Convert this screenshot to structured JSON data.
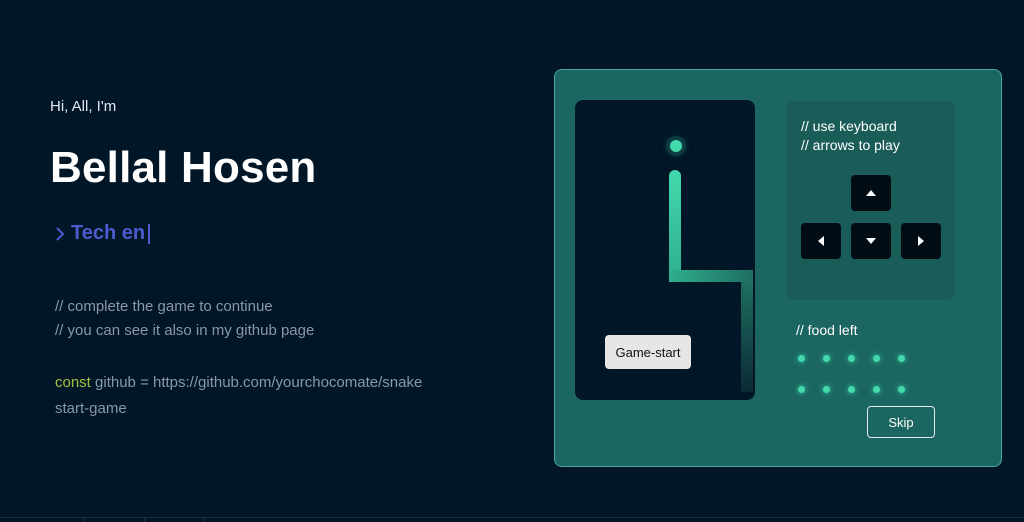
{
  "hero": {
    "greeting": "Hi, All, I'm",
    "name": "Bellal Hosen",
    "role_prefix": ">",
    "role": "Tech en"
  },
  "comments": [
    "// complete the game to continue",
    "// you can see it also in my github page"
  ],
  "code": {
    "keyword": "const",
    "rest": " github = https://github.com/yourchocomate/snake",
    "line2": "start-game"
  },
  "game": {
    "start_label": "Game-start",
    "instructions": [
      "// use keyboard",
      "// arrows to play"
    ],
    "food_left_label": "// food left",
    "food_left_count": 10,
    "skip_label": "Skip",
    "keys": [
      "arrow-up",
      "arrow-left",
      "arrow-down",
      "arrow-right"
    ]
  },
  "colors": {
    "background": "#011627",
    "accent": "#43d9ad",
    "role": "#4d5bce",
    "keyword": "#a4c03f",
    "panel": "#1b6660"
  }
}
